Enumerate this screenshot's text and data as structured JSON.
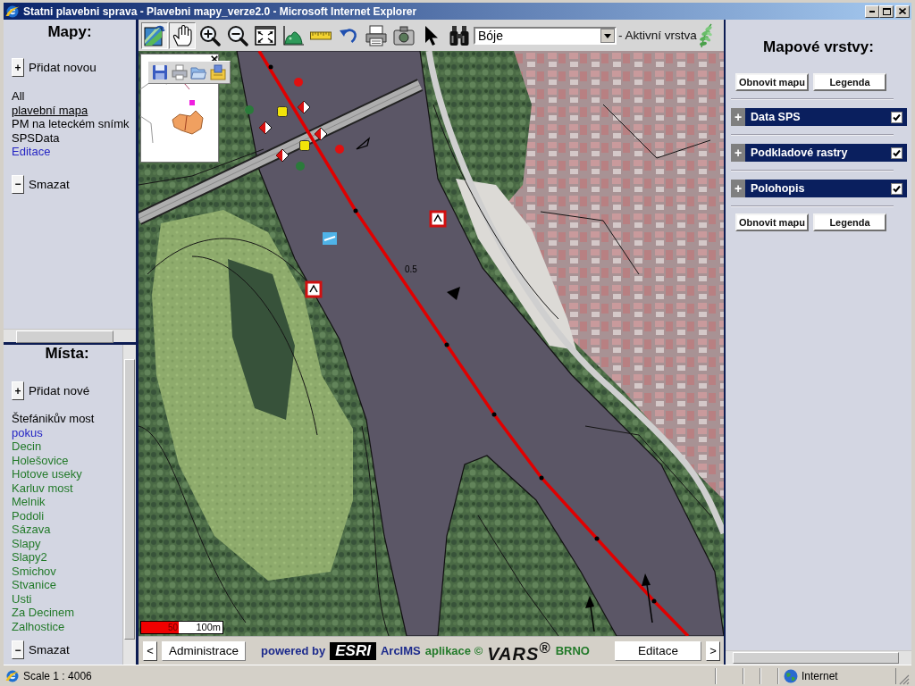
{
  "window": {
    "title": "Statni plavebni sprava - Plavebni mapy_verze2.0 - Microsoft Internet Explorer"
  },
  "maps_panel": {
    "title": "Mapy:",
    "add_button": {
      "symbol": "+",
      "label": "Přidat novou"
    },
    "items": [
      {
        "label": "All",
        "color": "#000000",
        "selected": false
      },
      {
        "label": "plavební mapa",
        "color": "#000000",
        "selected": true
      },
      {
        "label": "PM na leteckém snímk",
        "color": "#000000",
        "selected": false
      },
      {
        "label": "SPSData",
        "color": "#000000",
        "selected": false
      },
      {
        "label": "Editace",
        "color": "#2626c4",
        "selected": false
      }
    ],
    "delete_button": {
      "symbol": "−",
      "label": "Smazat"
    }
  },
  "places_panel": {
    "title": "Místa:",
    "add_button": {
      "symbol": "+",
      "label": "Přidat nové"
    },
    "items": [
      {
        "label": "Štefánikův most",
        "color": "#000000"
      },
      {
        "label": "pokus",
        "color": "#2626c4"
      },
      {
        "label": "Decin",
        "color": "#237a2a"
      },
      {
        "label": "Holešovice",
        "color": "#237a2a"
      },
      {
        "label": "Hotove useky",
        "color": "#237a2a"
      },
      {
        "label": "Karluv most",
        "color": "#237a2a"
      },
      {
        "label": "Melnik",
        "color": "#237a2a"
      },
      {
        "label": "Podoli",
        "color": "#237a2a"
      },
      {
        "label": "Sázava",
        "color": "#237a2a"
      },
      {
        "label": "Slapy",
        "color": "#237a2a"
      },
      {
        "label": "Slapy2",
        "color": "#237a2a"
      },
      {
        "label": "Smichov",
        "color": "#237a2a"
      },
      {
        "label": "Stvanice",
        "color": "#237a2a"
      },
      {
        "label": "Usti",
        "color": "#237a2a"
      },
      {
        "label": "Za Decinem",
        "color": "#237a2a"
      },
      {
        "label": "Zalhostice",
        "color": "#237a2a"
      }
    ],
    "delete_button": {
      "symbol": "−",
      "label": "Smazat"
    }
  },
  "toolbar": {
    "tools": [
      {
        "kind": "overview",
        "selected": true
      },
      {
        "kind": "pan",
        "selected": true
      },
      {
        "kind": "zoom_in",
        "selected": false
      },
      {
        "kind": "zoom_out",
        "selected": false
      },
      {
        "kind": "full_extent",
        "selected": false
      },
      {
        "kind": "identify",
        "selected": false
      },
      {
        "kind": "measure",
        "selected": false
      },
      {
        "kind": "undo",
        "selected": false
      },
      {
        "kind": "print",
        "selected": false
      },
      {
        "kind": "snapshot",
        "selected": false
      },
      {
        "kind": "select",
        "selected": false
      },
      {
        "kind": "find",
        "selected": false
      }
    ],
    "layer_select": {
      "value": "Bóje"
    },
    "layer_label": "- Aktivní vrstva"
  },
  "map": {
    "km_label": "0.5",
    "scale_bar": [
      "50",
      "100m"
    ]
  },
  "bottom_bar": {
    "prev_button": "<",
    "left_button": "Administrace",
    "credits": [
      {
        "kind": "text",
        "text": "powered by",
        "color": "#1c2a8c"
      },
      {
        "kind": "boxed_logo",
        "text": "ESRI"
      },
      {
        "kind": "text",
        "text": "ArcIMS",
        "color": "#1c2a8c"
      },
      {
        "kind": "text",
        "text": "aplikace ©",
        "color": "#237a2a"
      },
      {
        "kind": "logo",
        "text": "VARS$^{®}$"
      },
      {
        "kind": "text",
        "text": "BRNO",
        "color": "#237a2a"
      }
    ],
    "right_button": "Editace",
    "next_button": ">"
  },
  "layers_panel": {
    "title": "Mapové vrstvy:",
    "top_buttons": [
      "Obnovit mapu",
      "Legenda"
    ],
    "layers": [
      {
        "toggle": "+",
        "name": "Data SPS",
        "checked": true
      },
      {
        "toggle": "+",
        "name": "Podkladové rastry",
        "checked": true
      },
      {
        "toggle": "+",
        "name": "Polohopis",
        "checked": true
      }
    ],
    "bottom_buttons": [
      "Obnovit mapu",
      "Legenda"
    ]
  },
  "status_bar": {
    "text": "Scale 1 : 4006",
    "zone": "Internet"
  }
}
